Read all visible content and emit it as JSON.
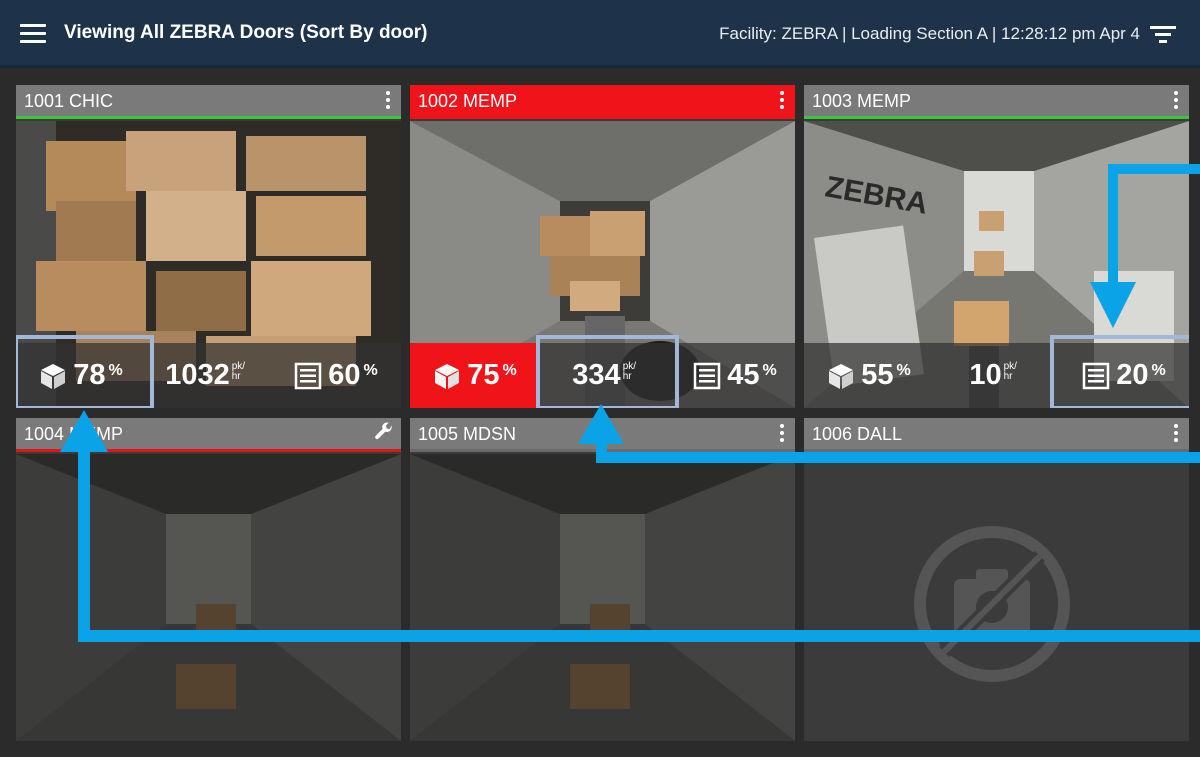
{
  "header": {
    "title": "Viewing All ZEBRA Doors (Sort By door)",
    "facility_info": "Facility: ZEBRA | Loading Section A | 12:28:12 pm Apr 4"
  },
  "doors": [
    {
      "label": "1001 CHIC",
      "status": "ok",
      "fullness": "78",
      "rate": "1032",
      "rate_unit_top": "pk/",
      "rate_unit_bottom": "hr",
      "density": "60",
      "pct": "%"
    },
    {
      "label": "1002 MEMP",
      "status": "alert",
      "fullness": "75",
      "rate": "334",
      "rate_unit_top": "pk/",
      "rate_unit_bottom": "hr",
      "density": "45",
      "pct": "%"
    },
    {
      "label": "1003 MEMP",
      "status": "ok",
      "fullness": "55",
      "rate": "10",
      "rate_unit_top": "pk/",
      "rate_unit_bottom": "hr",
      "density": "20",
      "pct": "%"
    },
    {
      "label": "1004 MEMP",
      "status": "fault"
    },
    {
      "label": "1005 MDSN",
      "status": "idle"
    },
    {
      "label": "1006 DALL",
      "status": "no-camera"
    }
  ],
  "icons": {
    "menu": "hamburger-icon",
    "filter": "filter-icon",
    "card_menu": "kebab-icon",
    "maintenance": "wrench-icon",
    "fullness": "box-icon",
    "density": "list-icon",
    "no_camera": "camera-off-icon"
  },
  "colors": {
    "header_bg": "#1e3349",
    "alert_red": "#f0141a",
    "ok_green": "#3cc63c",
    "tile_gray": "#7a7a7a",
    "callout_blue": "#0aa3e8",
    "highlight_frame": "#a3b7d6"
  }
}
